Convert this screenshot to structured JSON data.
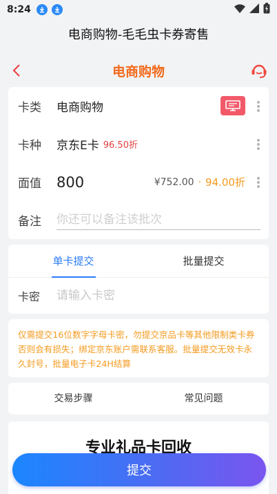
{
  "status_bar": {
    "time": "8:24"
  },
  "app_title": "电商购物-毛毛虫卡券寄售",
  "nav": {
    "title": "电商购物"
  },
  "form": {
    "type_label": "卡类",
    "type_value": "电商购物",
    "kind_label": "卡种",
    "kind_value": "京东E卡",
    "kind_discount": "96.50折",
    "face_label": "面值",
    "face_value": "800",
    "price": "¥752.00",
    "dot": "·",
    "price_discount": "94.00折",
    "remark_label": "备注",
    "remark_placeholder": "你还可以备注该批次"
  },
  "tabs": [
    {
      "label": "单卡提交",
      "active": true
    },
    {
      "label": "批量提交",
      "active": false
    }
  ],
  "card_pwd": {
    "label": "卡密",
    "placeholder": "请输入卡密"
  },
  "notice": "仅需提交16位数字字母卡密，勿提交京品卡等其他限制类卡券否则会有损失；绑定京东账户需联系客服。批量提交无效卡永久封号，批量电子卡24H结算",
  "links": {
    "steps": "交易步骤",
    "faq": "常见问题"
  },
  "promo": {
    "title": "专业礼品卡回收"
  },
  "submit_label": "提交",
  "colors": {
    "accent": "#f26b1d",
    "primary": "#2b7cf7",
    "notice": "#f39b20",
    "discount": "#e53e3e"
  }
}
